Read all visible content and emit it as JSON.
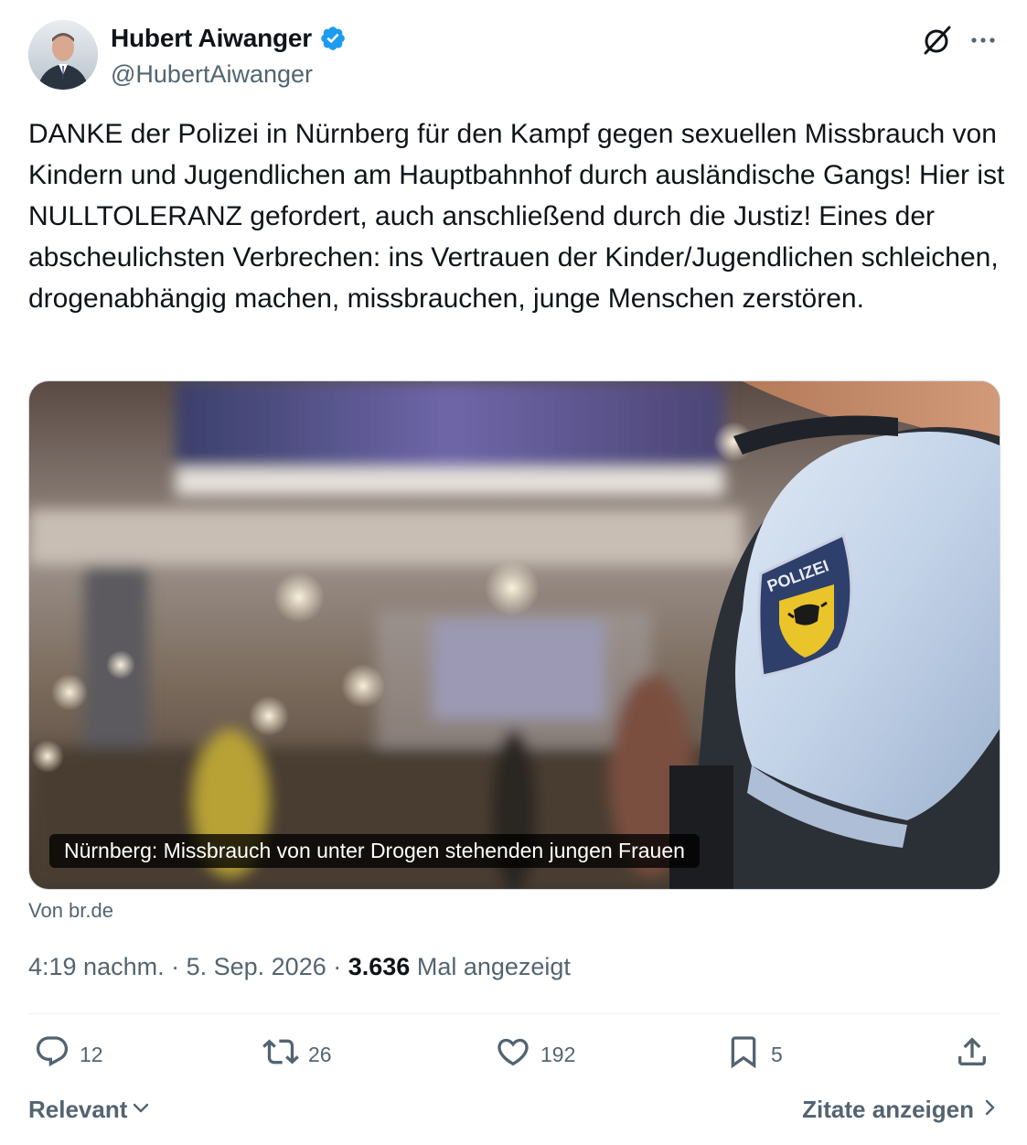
{
  "author": {
    "name": "Hubert Aiwanger",
    "handle": "@HubertAiwanger",
    "verified": true,
    "verified_color": "#1d9bf0"
  },
  "tweet": {
    "text": "DANKE der Polizei in Nürnberg für den Kampf gegen sexuellen Missbrauch von Kindern und Jugendlichen am Hauptbahnhof durch ausländische Gangs! Hier ist NULLTOLERANZ gefordert, auch anschließend durch die Justiz! Eines der abscheulichsten Verbrechen: ins Vertrauen der Kinder/Jugendlichen schleichen, drogenabhängig machen, missbrauchen, junge Menschen zerstören."
  },
  "card": {
    "caption": "Nürnberg: Missbrauch von unter Drogen stehenden jungen Frauen",
    "badge_text": "POLIZEI",
    "source": "Von br.de"
  },
  "meta": {
    "time": "4:19 nachm.",
    "separator": " · ",
    "date": "5. Sep. 2026",
    "views": "3.636",
    "views_label": "Mal angezeigt"
  },
  "actions": {
    "replies": "12",
    "reposts": "26",
    "likes": "192",
    "bookmarks": "5"
  },
  "footer": {
    "sort_label": "Relevant",
    "quotes_label": "Zitate anzeigen"
  },
  "icons": {
    "grok": "grok-icon",
    "more": "more-icon",
    "reply": "reply-icon",
    "repost": "repost-icon",
    "like": "heart-icon",
    "bookmark": "bookmark-icon",
    "share": "share-icon"
  }
}
